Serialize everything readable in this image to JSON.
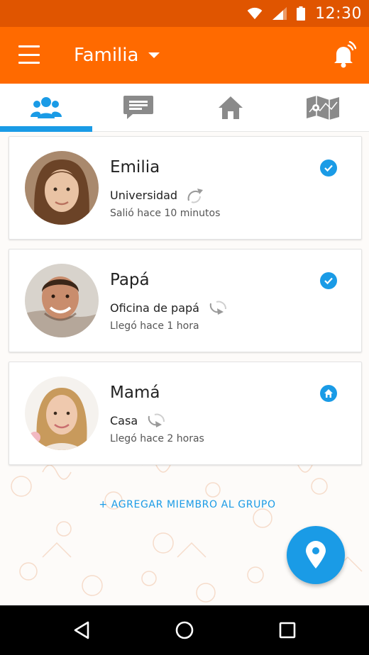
{
  "status_bar": {
    "time": "12:30",
    "icons": [
      "wifi-icon",
      "signal-icon",
      "battery-icon"
    ]
  },
  "app_bar": {
    "group_title": "Familia",
    "menu_icon": "menu-icon",
    "bell_icon": "bell-ringing-icon"
  },
  "tabs": [
    {
      "name": "tab-members",
      "icon": "group-icon",
      "active": true
    },
    {
      "name": "tab-chat",
      "icon": "chat-icon",
      "active": false
    },
    {
      "name": "tab-places",
      "icon": "home-icon",
      "active": false
    },
    {
      "name": "tab-map",
      "icon": "map-icon",
      "active": false
    }
  ],
  "members": [
    {
      "name": "Emilia",
      "place": "Universidad",
      "time": "Salió hace 10 minutos",
      "status": "checked",
      "movement": "departed"
    },
    {
      "name": "Papá",
      "place": "Oficina de papá",
      "time": "Llegó hace 1 hora",
      "status": "checked",
      "movement": "arrived"
    },
    {
      "name": "Mamá",
      "place": "Casa",
      "time": "Llegó hace 2 horas",
      "status": "home",
      "movement": "arrived"
    }
  ],
  "add_member_label": "+ AGREGAR MIEMBRO AL GRUPO",
  "colors": {
    "status_bar": "#e05500",
    "app_bar": "#ff6a00",
    "accent": "#1a9be6",
    "tab_icon": "#8a8a8a"
  }
}
